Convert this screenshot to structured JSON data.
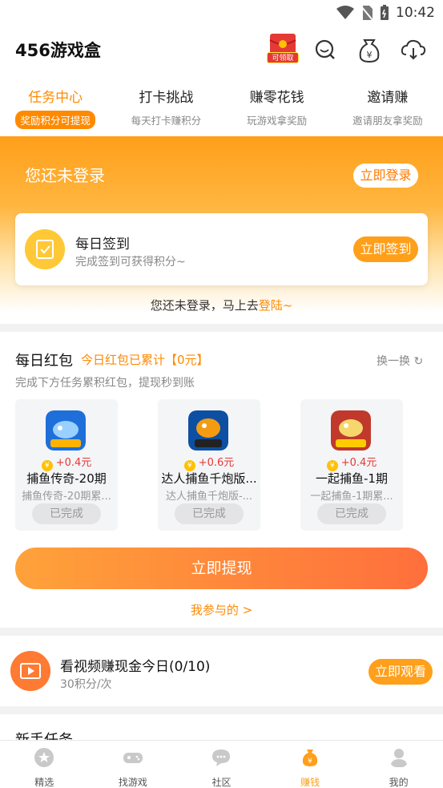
{
  "status": {
    "time": "10:42"
  },
  "header": {
    "title": "456游戏盒",
    "redpacket_label": "可领取"
  },
  "tabs": [
    {
      "title": "任务中心",
      "subtitle": "奖励积分可提现"
    },
    {
      "title": "打卡挑战",
      "subtitle": "每天打卡赚积分"
    },
    {
      "title": "赚零花钱",
      "subtitle": "玩游戏拿奖励"
    },
    {
      "title": "邀请赚",
      "subtitle": "邀请朋友拿奖励"
    }
  ],
  "hero": {
    "title": "您还未登录",
    "login_button": "立即登录"
  },
  "signin": {
    "title": "每日签到",
    "subtitle": "完成签到可获得积分~",
    "button": "立即签到"
  },
  "hint": {
    "text": "您还未登录，马上去",
    "link": "登陆~"
  },
  "daily": {
    "title": "每日红包",
    "total": "今日红包已累计【0元】",
    "refresh": "换一换",
    "subtitle": "完成下方任务累积红包，提现秒到账",
    "games": [
      {
        "reward": "+0.4元",
        "name": "捕鱼传奇-20期",
        "desc": "捕鱼传奇-20期累...",
        "status": "已完成"
      },
      {
        "reward": "+0.6元",
        "name": "达人捕鱼千炮版...",
        "desc": "达人捕鱼千炮版-...",
        "status": "已完成"
      },
      {
        "reward": "+0.4元",
        "name": "一起捕鱼-1期",
        "desc": "一起捕鱼-1期累...",
        "status": "已完成"
      }
    ],
    "withdraw_button": "立即提现",
    "joined_link": "我参与的 >"
  },
  "video": {
    "title": "看视频赚现金今日(0/10)",
    "subtitle": "30积分/次",
    "button": "立即观看"
  },
  "newbie": {
    "title": "新手任务"
  },
  "bottom_nav": [
    {
      "label": "精选"
    },
    {
      "label": "找游戏"
    },
    {
      "label": "社区"
    },
    {
      "label": "赚钱"
    },
    {
      "label": "我的"
    }
  ]
}
